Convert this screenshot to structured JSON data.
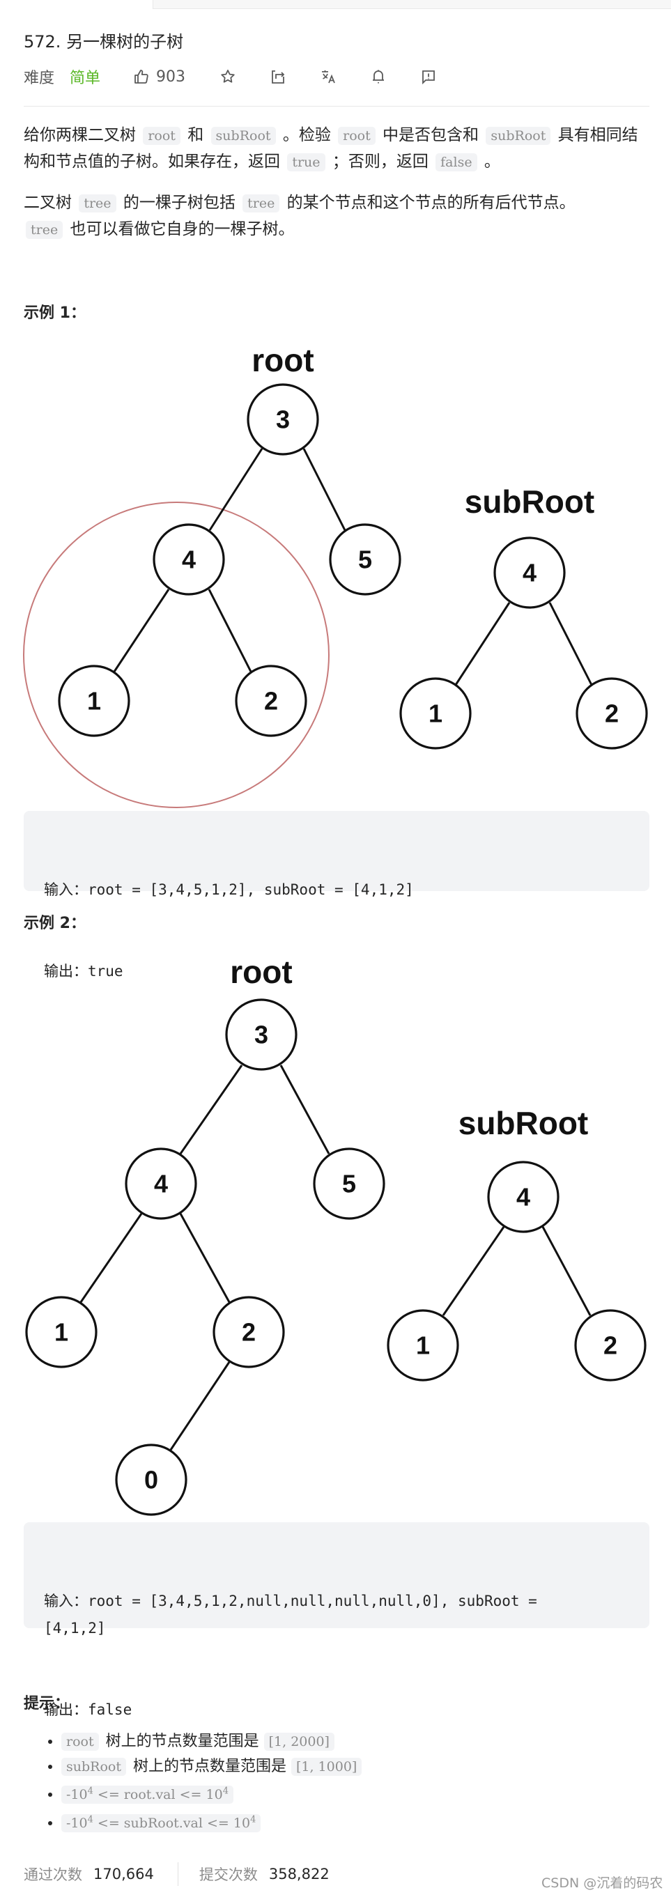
{
  "problem": {
    "title": "572. 另一棵树的子树",
    "difficulty_label": "难度",
    "difficulty_value": "简单",
    "likes": "903",
    "toolbar_icons": [
      "thumbs-up-icon",
      "star-icon",
      "share-icon",
      "translate-icon",
      "bell-icon",
      "feedback-icon"
    ]
  },
  "description": {
    "p1": [
      {
        "t": "text",
        "v": "给你两棵二叉树 "
      },
      {
        "t": "code",
        "v": "root"
      },
      {
        "t": "text",
        "v": " 和 "
      },
      {
        "t": "code",
        "v": "subRoot"
      },
      {
        "t": "text",
        "v": " 。检验 "
      },
      {
        "t": "code",
        "v": "root"
      },
      {
        "t": "text",
        "v": " 中是否包含和 "
      },
      {
        "t": "code",
        "v": "subRoot"
      },
      {
        "t": "text",
        "v": " 具有相同结构和节点值的子树。如果存在，返回 "
      },
      {
        "t": "code",
        "v": "true"
      },
      {
        "t": "text",
        "v": " ；否则，返回 "
      },
      {
        "t": "code",
        "v": "false"
      },
      {
        "t": "text",
        "v": " 。"
      }
    ],
    "p2": [
      {
        "t": "text",
        "v": "二叉树 "
      },
      {
        "t": "code",
        "v": "tree"
      },
      {
        "t": "text",
        "v": " 的一棵子树包括 "
      },
      {
        "t": "code",
        "v": "tree"
      },
      {
        "t": "text",
        "v": " 的某个节点和这个节点的所有后代节点。"
      },
      {
        "t": "br",
        "v": ""
      },
      {
        "t": "code",
        "v": "tree"
      },
      {
        "t": "text",
        "v": " 也可以看做它自身的一棵子树。"
      }
    ]
  },
  "examples": [
    {
      "title": "示例 1：",
      "diagram": {
        "root_label": "root",
        "subroot_label": "subRoot",
        "root_tree": [
          "3",
          "4",
          "5",
          "1",
          "2"
        ],
        "subroot_tree": [
          "4",
          "1",
          "2"
        ],
        "highlighted_subtree_root": "4"
      },
      "input_line": "输入：root = [3,4,5,1,2], subRoot = [4,1,2]",
      "output_line": "输出：true"
    },
    {
      "title": "示例 2：",
      "diagram": {
        "root_label": "root",
        "subroot_label": "subRoot",
        "root_tree": [
          "3",
          "4",
          "5",
          "1",
          "2",
          "0"
        ],
        "subroot_tree": [
          "4",
          "1",
          "2"
        ]
      },
      "input_line": "输入：root = [3,4,5,1,2,null,null,null,null,0], subRoot =\n[4,1,2]",
      "output_line": "输出：false"
    }
  ],
  "hints": {
    "title": "提示：",
    "items": [
      {
        "code1": "root",
        "text": " 树上的节点数量范围是 ",
        "code2": "[1, 2000]"
      },
      {
        "code1": "subRoot",
        "text": " 树上的节点数量范围是 ",
        "code2": "[1, 1000]"
      },
      {
        "pre": "-10",
        "sup": "4",
        "mid": " <= root.val <= 10",
        "sup2": "4"
      },
      {
        "pre": "-10",
        "sup": "4",
        "mid": " <= subRoot.val <= 10",
        "sup2": "4"
      }
    ]
  },
  "stats": {
    "accepted_label": "通过次数",
    "accepted_value": "170,664",
    "submissions_label": "提交次数",
    "submissions_value": "358,822"
  },
  "watermark": "CSDN @沉着的码农",
  "colors": {
    "easy_green": "#5ab726",
    "highlight_circle": "#c77a7a",
    "code_bg": "#f2f3f5"
  }
}
